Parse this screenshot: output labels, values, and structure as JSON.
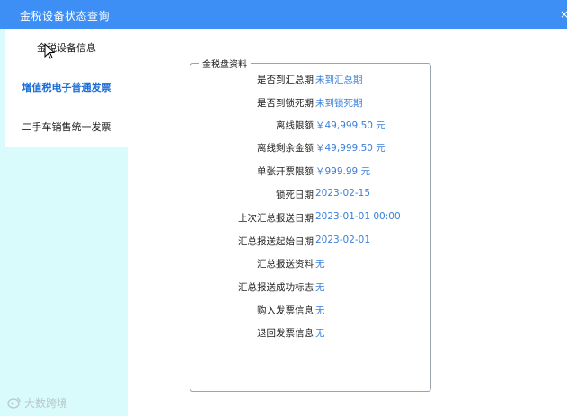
{
  "window": {
    "title": "金税设备状态查询"
  },
  "sidebar": {
    "items": [
      {
        "label": "金税设备信息"
      },
      {
        "label": "增值税电子普通发票"
      },
      {
        "label": "二手车销售统一发票"
      }
    ]
  },
  "panel": {
    "legend": "金税盘资料",
    "rows": [
      {
        "label": "是否到汇总期",
        "value": "未到汇总期"
      },
      {
        "label": "是否到锁死期",
        "value": "未到锁死期"
      },
      {
        "label": "离线限额",
        "value": "￥49,999.50 元"
      },
      {
        "label": "离线剩余金额",
        "value": "￥49,999.50 元"
      },
      {
        "label": "单张开票限额",
        "value": "￥999.99 元"
      },
      {
        "label": "锁死日期",
        "value": "2023-02-15"
      },
      {
        "label": "上次汇总报送日期",
        "value": "2023-01-01 00:00"
      },
      {
        "label": "汇总报送起始日期",
        "value": "2023-02-01"
      },
      {
        "label": "汇总报送资料",
        "value": "无"
      },
      {
        "label": "汇总报送成功标志",
        "value": "无"
      },
      {
        "label": "购入发票信息",
        "value": "无"
      },
      {
        "label": "退回发票信息",
        "value": "无"
      }
    ]
  },
  "watermark": {
    "text": "大数跨境"
  },
  "colors": {
    "titlebar": "#3d8ef5",
    "sidebar": "#d9fbfb",
    "value_text": "#3a7fd8",
    "active_item": "#1a6bd6"
  }
}
